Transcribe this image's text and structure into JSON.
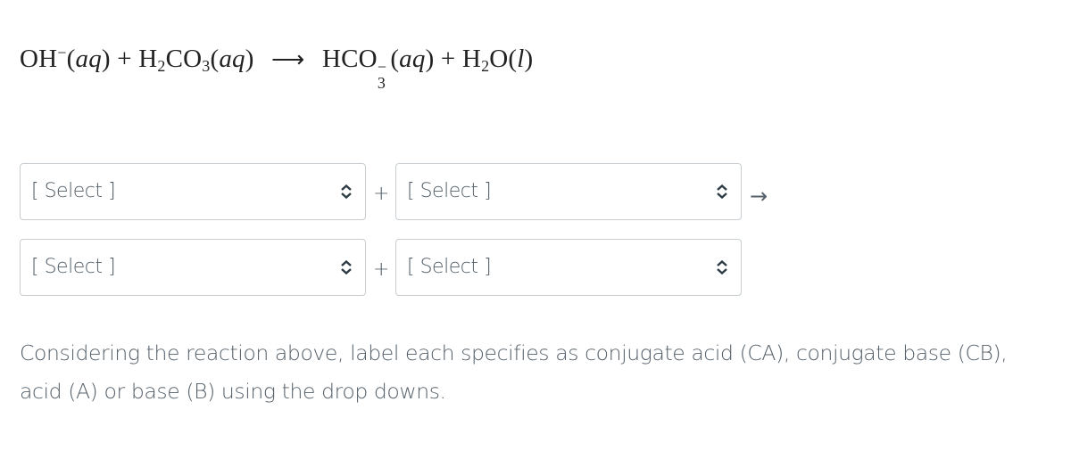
{
  "equation": {
    "reactant1": {
      "formula": "OH",
      "charge": "−",
      "state": "aq"
    },
    "plus1": "+",
    "reactant2": {
      "formula_parts": [
        "H",
        "2",
        "CO",
        "3"
      ],
      "state": "aq"
    },
    "arrow": "⟶",
    "product1": {
      "formula": "HCO",
      "subscript": "3",
      "charge": "−",
      "state": "aq"
    },
    "plus2": "+",
    "product2": {
      "formula_parts": [
        "H",
        "2",
        "O"
      ],
      "state": "l"
    }
  },
  "reactants_row": {
    "select1": {
      "value": "[ Select ]",
      "icon": "up-down-chevron-icon"
    },
    "plus": "+",
    "select2": {
      "value": "[ Select ]",
      "icon": "up-down-chevron-icon"
    },
    "arrow": "→"
  },
  "products_row": {
    "select1": {
      "value": "[ Select ]",
      "icon": "up-down-chevron-icon"
    },
    "plus": "+",
    "select2": {
      "value": "[ Select ]",
      "icon": "up-down-chevron-icon"
    }
  },
  "instructions": "Considering the reaction above, label each specifies as conjugate acid (CA), conjugate base (CB), acid (A) or base (B) using the drop downs."
}
